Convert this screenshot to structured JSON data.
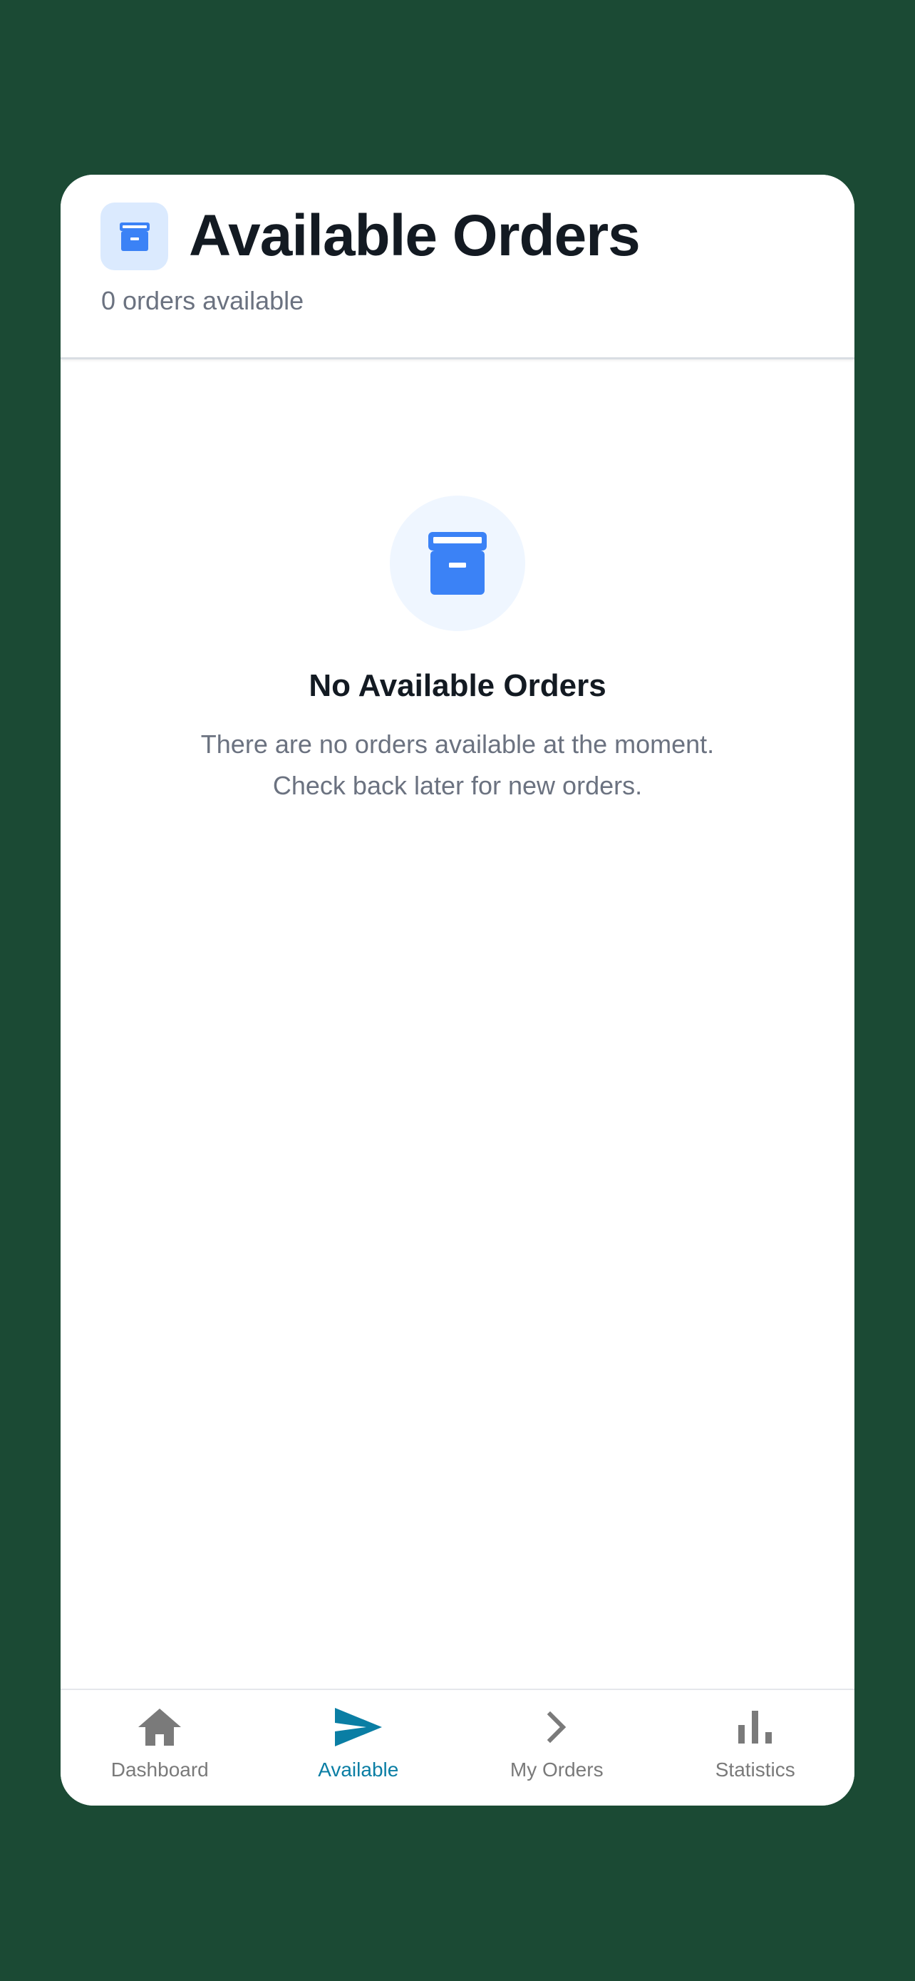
{
  "header": {
    "title": "Available Orders",
    "subtitle": "0 orders available",
    "icon": "archive-box-icon"
  },
  "empty_state": {
    "icon": "archive-box-icon",
    "title": "No Available Orders",
    "message_line1": "There are no orders available at the moment.",
    "message_line2": "Check back later for new orders."
  },
  "tab_bar": {
    "items": [
      {
        "label": "Dashboard",
        "icon": "home-icon",
        "active": false
      },
      {
        "label": "Available",
        "icon": "send-icon",
        "active": true
      },
      {
        "label": "My Orders",
        "icon": "chevron-right-icon",
        "active": false
      },
      {
        "label": "Statistics",
        "icon": "bar-chart-icon",
        "active": false
      }
    ]
  },
  "colors": {
    "background": "#1b4a34",
    "accent_blue": "#3b82f6",
    "active_tab": "#0a7ea4",
    "inactive_tab": "#7a7a7a",
    "title_text": "#131a22",
    "muted_text": "#6b7280"
  }
}
